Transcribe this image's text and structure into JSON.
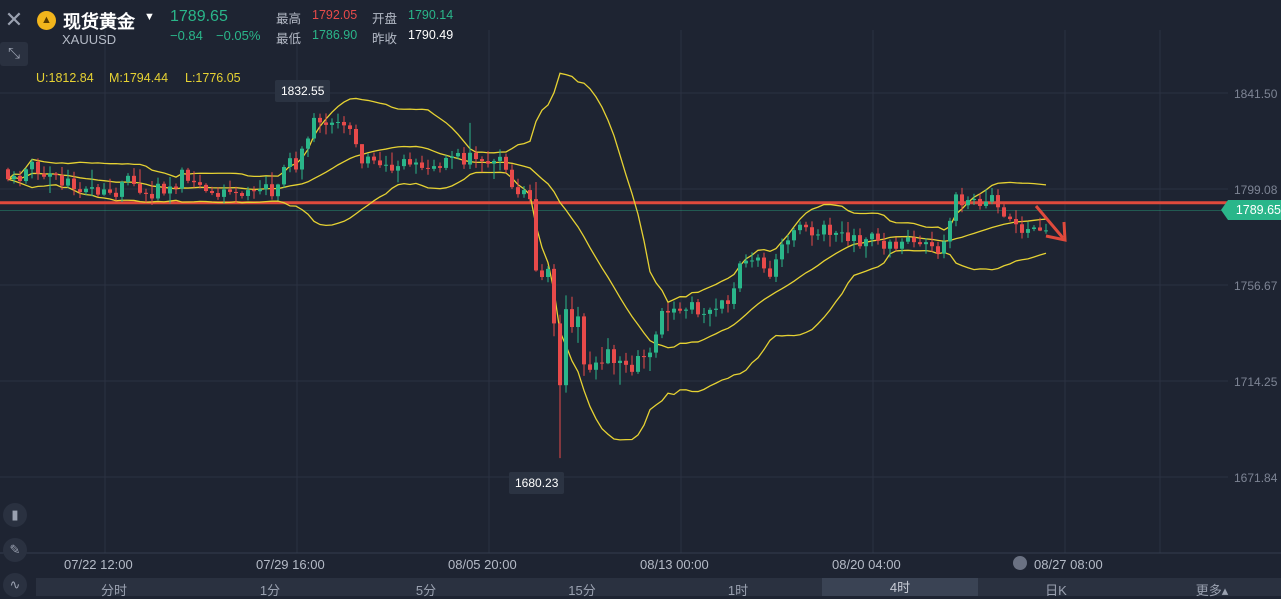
{
  "header": {
    "close_icon": "close-icon",
    "expand_icon": "expand-arrows-icon",
    "logo_icon": "gold-bars-icon",
    "name": "现货黄金",
    "code": "XAUUSD",
    "price": "1789.65",
    "change": "−0.84",
    "change_pct": "−0.05%",
    "high_label": "最高",
    "high": "1792.05",
    "open_label": "开盘",
    "open": "1790.14",
    "low_label": "最低",
    "low": "1786.90",
    "prev_label": "昨收",
    "prev": "1790.49"
  },
  "indicator": {
    "upper": "U:1812.84",
    "middle": "M:1794.44",
    "lower": "L:1776.05"
  },
  "tabs": [
    {
      "label": "分时",
      "active": false
    },
    {
      "label": "1分",
      "active": false
    },
    {
      "label": "5分",
      "active": false
    },
    {
      "label": "15分",
      "active": false
    },
    {
      "label": "1时",
      "active": false
    },
    {
      "label": "4时",
      "active": true
    },
    {
      "label": "日K",
      "active": false
    },
    {
      "label": "更多▴",
      "active": false
    }
  ],
  "left_tools": [
    "candlestick-icon",
    "pencil-icon",
    "indicator-icon"
  ],
  "chart_data": {
    "type": "candlestick",
    "instrument": "XAUUSD",
    "y_ticks": [
      1841.5,
      1799.08,
      1756.67,
      1714.25,
      1671.84
    ],
    "y_tick_labels": [
      "1841.50",
      "1799.08",
      "1756.67",
      "1714.25",
      "1671.84"
    ],
    "x_tick_labels": [
      "07/22 12:00",
      "07/29 16:00",
      "08/05 20:00",
      "08/13 00:00",
      "08/20 04:00",
      "08/27 08:00"
    ],
    "last_price": 1789.65,
    "last_price_label": "1789.65",
    "horizontal_line": 1793.0,
    "annotations": [
      {
        "label": "1832.55",
        "value": 1832.55
      },
      {
        "label": "1680.23",
        "value": 1680.23
      }
    ],
    "ohlc": [
      [
        1807.8,
        1808.5,
        1802.5,
        1803.4
      ],
      [
        1803.4,
        1806.9,
        1801.5,
        1804.9
      ],
      [
        1804.9,
        1807.1,
        1800.3,
        1802.6
      ],
      [
        1802.6,
        1808.5,
        1801.4,
        1807.8
      ],
      [
        1807.8,
        1812.4,
        1803.8,
        1811.1
      ],
      [
        1811.1,
        1812.6,
        1803.1,
        1805.9
      ],
      [
        1805.9,
        1809.1,
        1803.4,
        1804.5
      ],
      [
        1804.5,
        1809.1,
        1797.3,
        1805.9
      ],
      [
        1805.9,
        1806.6,
        1803.1,
        1805.2
      ],
      [
        1805.2,
        1808.8,
        1798.7,
        1800.6
      ],
      [
        1800.6,
        1807.6,
        1799.5,
        1803.7
      ],
      [
        1803.7,
        1806.7,
        1796.3,
        1799.0
      ],
      [
        1799.0,
        1802.1,
        1795.1,
        1797.7
      ],
      [
        1797.7,
        1800.3,
        1796.3,
        1799.2
      ],
      [
        1799.2,
        1807.6,
        1795.9,
        1799.9
      ],
      [
        1799.9,
        1801.3,
        1795.5,
        1796.6
      ],
      [
        1796.6,
        1801.7,
        1796.1,
        1798.9
      ],
      [
        1798.9,
        1803.6,
        1796.6,
        1797.4
      ],
      [
        1797.4,
        1799.7,
        1794.0,
        1795.6
      ],
      [
        1795.6,
        1802.8,
        1793.4,
        1802.2
      ],
      [
        1802.2,
        1806.1,
        1800.7,
        1804.9
      ],
      [
        1804.9,
        1808.3,
        1800.3,
        1801.3
      ],
      [
        1801.3,
        1807.8,
        1796.7,
        1797.4
      ],
      [
        1797.4,
        1799.2,
        1793.1,
        1796.9
      ],
      [
        1796.9,
        1802.6,
        1792.0,
        1794.9
      ],
      [
        1794.9,
        1804.1,
        1794.1,
        1801.4
      ],
      [
        1801.4,
        1802.4,
        1796.2,
        1797.1
      ],
      [
        1797.1,
        1804.4,
        1792.6,
        1800.2
      ],
      [
        1800.2,
        1801.5,
        1796.9,
        1799.3
      ],
      [
        1799.3,
        1808.6,
        1797.5,
        1807.6
      ],
      [
        1807.6,
        1808.4,
        1801.6,
        1802.7
      ],
      [
        1802.7,
        1806.9,
        1799.7,
        1802.1
      ],
      [
        1802.1,
        1805.4,
        1799.3,
        1800.9
      ],
      [
        1800.9,
        1801.6,
        1797.5,
        1798.2
      ],
      [
        1798.2,
        1800.1,
        1796.4,
        1797.3
      ],
      [
        1797.3,
        1799.9,
        1794.3,
        1795.6
      ],
      [
        1795.6,
        1801.1,
        1792.6,
        1798.9
      ],
      [
        1798.9,
        1802.8,
        1796.6,
        1797.8
      ],
      [
        1797.8,
        1800.1,
        1792.7,
        1797.3
      ],
      [
        1797.3,
        1798.1,
        1794.9,
        1796.0
      ],
      [
        1796.0,
        1800.0,
        1794.1,
        1798.6
      ],
      [
        1798.6,
        1800.3,
        1794.8,
        1798.1
      ],
      [
        1798.1,
        1803.0,
        1796.7,
        1799.0
      ],
      [
        1799.0,
        1804.8,
        1796.4,
        1801.2
      ],
      [
        1801.2,
        1806.5,
        1794.4,
        1795.9
      ],
      [
        1795.9,
        1801.4,
        1794.0,
        1801.1
      ],
      [
        1801.1,
        1809.8,
        1799.6,
        1808.8
      ],
      [
        1808.8,
        1815.1,
        1806.5,
        1812.7
      ],
      [
        1812.7,
        1815.6,
        1806.4,
        1807.7
      ],
      [
        1807.7,
        1818.0,
        1803.3,
        1816.9
      ],
      [
        1816.9,
        1822.3,
        1813.2,
        1821.4
      ],
      [
        1821.4,
        1832.6,
        1819.8,
        1830.5
      ],
      [
        1830.5,
        1832.4,
        1823.9,
        1828.5
      ],
      [
        1828.5,
        1832.5,
        1823.2,
        1827.4
      ],
      [
        1827.4,
        1830.3,
        1823.6,
        1828.4
      ],
      [
        1828.4,
        1832.4,
        1825.8,
        1828.7
      ],
      [
        1828.7,
        1831.3,
        1823.7,
        1827.2
      ],
      [
        1827.2,
        1828.5,
        1823.0,
        1825.6
      ],
      [
        1825.6,
        1827.5,
        1817.5,
        1818.9
      ],
      [
        1818.9,
        1818.9,
        1808.2,
        1810.4
      ],
      [
        1810.4,
        1815.0,
        1808.5,
        1813.4
      ],
      [
        1813.4,
        1815.2,
        1810.1,
        1811.7
      ],
      [
        1811.7,
        1815.5,
        1808.4,
        1809.6
      ],
      [
        1809.6,
        1813.7,
        1806.7,
        1809.8
      ],
      [
        1809.8,
        1815.2,
        1806.1,
        1807.2
      ],
      [
        1807.2,
        1811.6,
        1802.0,
        1809.2
      ],
      [
        1809.2,
        1814.3,
        1807.7,
        1812.3
      ],
      [
        1812.3,
        1815.2,
        1808.9,
        1809.9
      ],
      [
        1809.9,
        1812.5,
        1805.8,
        1810.8
      ],
      [
        1810.8,
        1813.8,
        1807.4,
        1808.4
      ],
      [
        1808.4,
        1812.0,
        1805.4,
        1808.0
      ],
      [
        1808.0,
        1812.0,
        1806.9,
        1809.2
      ],
      [
        1809.2,
        1810.8,
        1806.4,
        1808.4
      ],
      [
        1808.4,
        1814.1,
        1807.4,
        1812.8
      ],
      [
        1812.8,
        1815.9,
        1808.0,
        1813.5
      ],
      [
        1813.5,
        1816.8,
        1812.1,
        1815.0
      ],
      [
        1815.0,
        1817.6,
        1808.0,
        1809.9
      ],
      [
        1809.9,
        1828.3,
        1807.9,
        1815.1
      ],
      [
        1815.1,
        1818.0,
        1808.4,
        1812.3
      ],
      [
        1812.3,
        1813.5,
        1806.5,
        1811.4
      ],
      [
        1811.4,
        1815.8,
        1808.6,
        1810.3
      ],
      [
        1810.3,
        1812.4,
        1803.5,
        1811.5
      ],
      [
        1811.5,
        1816.6,
        1807.3,
        1813.3
      ],
      [
        1813.3,
        1814.7,
        1806.1,
        1807.6
      ],
      [
        1807.6,
        1810.0,
        1799.1,
        1799.9
      ],
      [
        1799.9,
        1803.6,
        1795.3,
        1796.8
      ],
      [
        1796.8,
        1800.4,
        1795.2,
        1798.6
      ],
      [
        1798.6,
        1801.0,
        1792.9,
        1794.6
      ],
      [
        1794.6,
        1802.2,
        1762.6,
        1763.1
      ],
      [
        1763.1,
        1765.9,
        1758.8,
        1760.2
      ],
      [
        1760.2,
        1765.1,
        1757.9,
        1763.8
      ],
      [
        1763.8,
        1765.9,
        1734.0,
        1739.7
      ],
      [
        1739.7,
        1743.5,
        1680.2,
        1712.4
      ],
      [
        1712.4,
        1752.1,
        1709.1,
        1746.0
      ],
      [
        1746.0,
        1751.5,
        1735.6,
        1738.1
      ],
      [
        1738.1,
        1747.0,
        1731.1,
        1742.8
      ],
      [
        1742.8,
        1744.2,
        1716.5,
        1721.6
      ],
      [
        1721.6,
        1727.3,
        1718.0,
        1719.2
      ],
      [
        1719.2,
        1725.1,
        1714.9,
        1722.4
      ],
      [
        1722.4,
        1729.3,
        1719.2,
        1722.1
      ],
      [
        1722.1,
        1733.2,
        1721.7,
        1728.3
      ],
      [
        1728.3,
        1730.2,
        1717.1,
        1722.2
      ],
      [
        1722.2,
        1725.2,
        1712.6,
        1723.2
      ],
      [
        1723.2,
        1726.7,
        1717.9,
        1721.4
      ],
      [
        1721.4,
        1725.5,
        1716.7,
        1718.3
      ],
      [
        1718.3,
        1727.9,
        1717.4,
        1725.3
      ],
      [
        1725.3,
        1728.1,
        1719.7,
        1724.8
      ],
      [
        1724.8,
        1729.0,
        1718.7,
        1726.8
      ],
      [
        1726.8,
        1736.2,
        1724.5,
        1734.8
      ],
      [
        1734.8,
        1746.5,
        1733.2,
        1745.2
      ],
      [
        1745.2,
        1748.8,
        1736.3,
        1744.5
      ],
      [
        1744.5,
        1749.4,
        1741.3,
        1746.2
      ],
      [
        1746.2,
        1749.0,
        1744.1,
        1745.3
      ],
      [
        1745.3,
        1746.7,
        1741.8,
        1745.8
      ],
      [
        1745.8,
        1751.6,
        1743.9,
        1749.1
      ],
      [
        1749.1,
        1750.5,
        1742.4,
        1743.7
      ],
      [
        1743.7,
        1746.5,
        1739.8,
        1743.9
      ],
      [
        1743.9,
        1746.7,
        1738.4,
        1745.7
      ],
      [
        1745.7,
        1750.7,
        1742.7,
        1746.2
      ],
      [
        1746.2,
        1750.1,
        1744.1,
        1749.9
      ],
      [
        1749.9,
        1752.2,
        1744.5,
        1748.3
      ],
      [
        1748.3,
        1757.9,
        1746.0,
        1755.2
      ],
      [
        1755.2,
        1767.2,
        1753.6,
        1766.2
      ],
      [
        1766.2,
        1770.2,
        1764.4,
        1767.4
      ],
      [
        1767.4,
        1771.1,
        1764.4,
        1767.5
      ],
      [
        1767.5,
        1770.2,
        1764.7,
        1768.8
      ],
      [
        1768.8,
        1771.0,
        1762.1,
        1764.0
      ],
      [
        1764.0,
        1767.4,
        1759.4,
        1760.3
      ],
      [
        1760.3,
        1770.4,
        1758.0,
        1768.0
      ],
      [
        1768.0,
        1777.2,
        1764.6,
        1774.6
      ],
      [
        1774.6,
        1778.8,
        1770.7,
        1776.4
      ],
      [
        1776.4,
        1781.9,
        1773.5,
        1780.9
      ],
      [
        1780.9,
        1784.8,
        1779.1,
        1783.3
      ],
      [
        1783.3,
        1784.6,
        1780.3,
        1782.2
      ],
      [
        1782.2,
        1784.8,
        1774.0,
        1778.6
      ],
      [
        1778.6,
        1781.3,
        1776.6,
        1779.0
      ],
      [
        1779.0,
        1785.1,
        1776.0,
        1783.3
      ],
      [
        1783.3,
        1786.4,
        1773.6,
        1778.8
      ],
      [
        1778.8,
        1780.6,
        1775.8,
        1779.7
      ],
      [
        1779.7,
        1784.8,
        1775.5,
        1779.9
      ],
      [
        1779.9,
        1784.5,
        1774.0,
        1776.1
      ],
      [
        1776.1,
        1781.5,
        1771.2,
        1778.7
      ],
      [
        1778.7,
        1781.7,
        1772.7,
        1773.8
      ],
      [
        1773.8,
        1777.7,
        1768.7,
        1776.9
      ],
      [
        1776.9,
        1780.1,
        1773.8,
        1779.4
      ],
      [
        1779.4,
        1781.8,
        1774.5,
        1776.2
      ],
      [
        1776.2,
        1779.7,
        1770.1,
        1772.7
      ],
      [
        1772.7,
        1776.8,
        1768.8,
        1775.8
      ],
      [
        1775.8,
        1777.7,
        1771.6,
        1772.7
      ],
      [
        1772.7,
        1777.3,
        1770.3,
        1775.8
      ],
      [
        1775.8,
        1781.0,
        1774.8,
        1777.7
      ],
      [
        1777.7,
        1780.7,
        1773.3,
        1775.6
      ],
      [
        1775.6,
        1778.5,
        1773.7,
        1774.7
      ],
      [
        1774.7,
        1777.4,
        1770.5,
        1775.6
      ],
      [
        1775.6,
        1780.2,
        1771.3,
        1773.8
      ],
      [
        1773.8,
        1775.8,
        1768.2,
        1770.5
      ],
      [
        1770.5,
        1778.9,
        1768.5,
        1775.9
      ],
      [
        1775.9,
        1786.4,
        1772.9,
        1785.0
      ],
      [
        1785.0,
        1797.7,
        1782.6,
        1796.7
      ],
      [
        1796.7,
        1799.6,
        1788.8,
        1791.9
      ],
      [
        1791.9,
        1795.8,
        1790.2,
        1794.2
      ],
      [
        1794.2,
        1797.0,
        1792.0,
        1794.7
      ],
      [
        1794.7,
        1797.1,
        1790.0,
        1791.6
      ],
      [
        1791.6,
        1799.0,
        1790.5,
        1793.5
      ],
      [
        1793.5,
        1799.5,
        1792.4,
        1796.4
      ],
      [
        1796.4,
        1799.0,
        1788.3,
        1791.0
      ],
      [
        1791.0,
        1792.4,
        1786.5,
        1786.9
      ],
      [
        1786.9,
        1788.2,
        1784.8,
        1785.8
      ],
      [
        1785.8,
        1789.7,
        1779.6,
        1783.5
      ],
      [
        1783.5,
        1787.0,
        1777.2,
        1779.7
      ],
      [
        1779.7,
        1784.6,
        1777.5,
        1781.4
      ],
      [
        1781.4,
        1783.1,
        1780.5,
        1782.1
      ],
      [
        1782.1,
        1786.4,
        1780.5,
        1780.7
      ],
      [
        1780.7,
        1783.7,
        1779.3,
        1780.8
      ]
    ],
    "bollinger": {
      "upper_label": "U",
      "middle_label": "M",
      "lower_label": "L",
      "upper_last": 1812.84,
      "middle_last": 1794.44,
      "lower_last": 1776.05
    }
  }
}
